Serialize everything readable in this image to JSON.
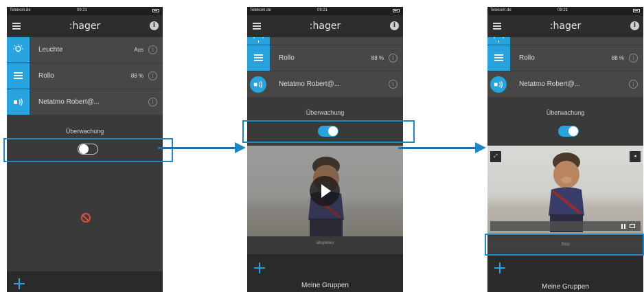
{
  "colors": {
    "accent": "#29a3dd",
    "highlight": "#1d87c2",
    "danger": "#e0503e",
    "background": "#3a3a3a"
  },
  "status_bar": {
    "carrier": "Telekom.de",
    "time": "09:21"
  },
  "app": {
    "brand": ":hager",
    "menu_icon": "hamburger-icon",
    "info_icon": "info-icon"
  },
  "devices": {
    "light": {
      "name": "Leuchte",
      "value": "Aus",
      "icon": "lightbulb-icon"
    },
    "blind": {
      "name": "Rollo",
      "value": "88 %",
      "icon": "blind-icon"
    },
    "camera": {
      "name": "Netatmo Robert@...",
      "name_short": "Netatmo Robert@...",
      "icon": "camera-sound-icon"
    }
  },
  "surveillance": {
    "label": "Überwachung",
    "screen1_state": "off",
    "screen2_state": "on",
    "screen3_state": "on",
    "disabled_icon": "prohibited-icon"
  },
  "video": {
    "caption_screen2": "abspielen",
    "stop_label": "Stop",
    "play_icon": "play-icon",
    "pause_icon": "pause-icon",
    "fullscreen_icon": "fullscreen-icon"
  },
  "footer": {
    "groups_label": "Meine Gruppen",
    "add_icon": "plus-icon"
  }
}
